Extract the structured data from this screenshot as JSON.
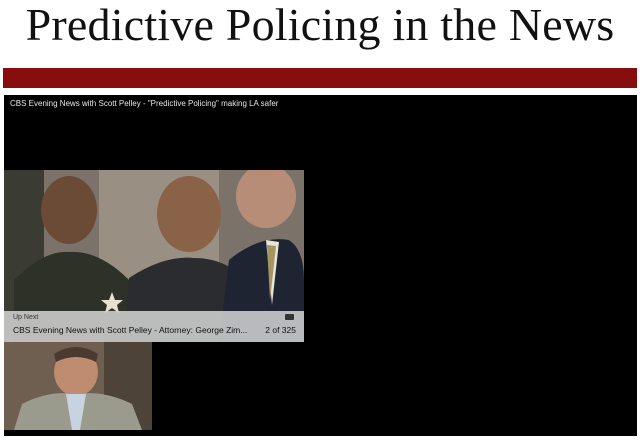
{
  "page": {
    "title": "Predictive Policing in the News"
  },
  "player": {
    "title": "CBS Evening News with Scott Pelley - \"Predictive Policing\" making LA safer",
    "up_next": {
      "label": "Up Next",
      "text": "CBS Evening News with Scott Pelley - Attorney: George Zim...",
      "count": "2 of 325"
    }
  },
  "colors": {
    "accent_bar": "#880d0d",
    "player_bg": "#000000"
  }
}
